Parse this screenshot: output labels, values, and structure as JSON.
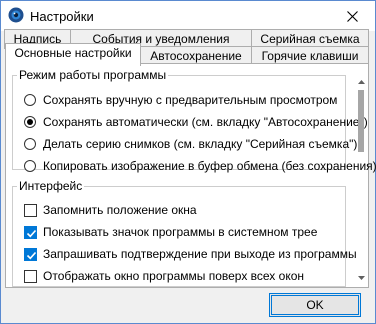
{
  "window": {
    "title": "Настройки",
    "close_symbol": "✕"
  },
  "tabs_back": [
    {
      "label": "Надпись"
    },
    {
      "label": "События и уведомления"
    },
    {
      "label": "Серийная съемка"
    }
  ],
  "tabs_front": [
    {
      "label": "Основные настройки",
      "active": true
    },
    {
      "label": "Автосохранение"
    },
    {
      "label": "Горячие клавиши"
    }
  ],
  "mode_group": {
    "title": "Режим работы программы",
    "options": [
      {
        "label": "Сохранять вручную с предварительным просмотром",
        "checked": false
      },
      {
        "label": "Сохранять автоматически (см. вкладку \"Автосохранение\")",
        "checked": true
      },
      {
        "label": "Делать серию снимков (см. вкладку \"Серийная съемка\")",
        "checked": false
      },
      {
        "label": "Копировать изображение в буфер обмена (без сохранения)",
        "checked": false
      }
    ]
  },
  "interface_group": {
    "title": "Интерфейс",
    "options": [
      {
        "label": "Запомнить положение окна",
        "checked": false
      },
      {
        "label": "Показывать значок программы в системном трее",
        "checked": true
      },
      {
        "label": "Запрашивать подтверждение при выходе из программы",
        "checked": true
      },
      {
        "label": "Отображать окно программы поверх всех окон",
        "checked": false
      }
    ]
  },
  "buttons": {
    "ok": "OK"
  },
  "colors": {
    "accent": "#0078d7",
    "border": "#adadad",
    "window_border": "#5a8ad0"
  }
}
